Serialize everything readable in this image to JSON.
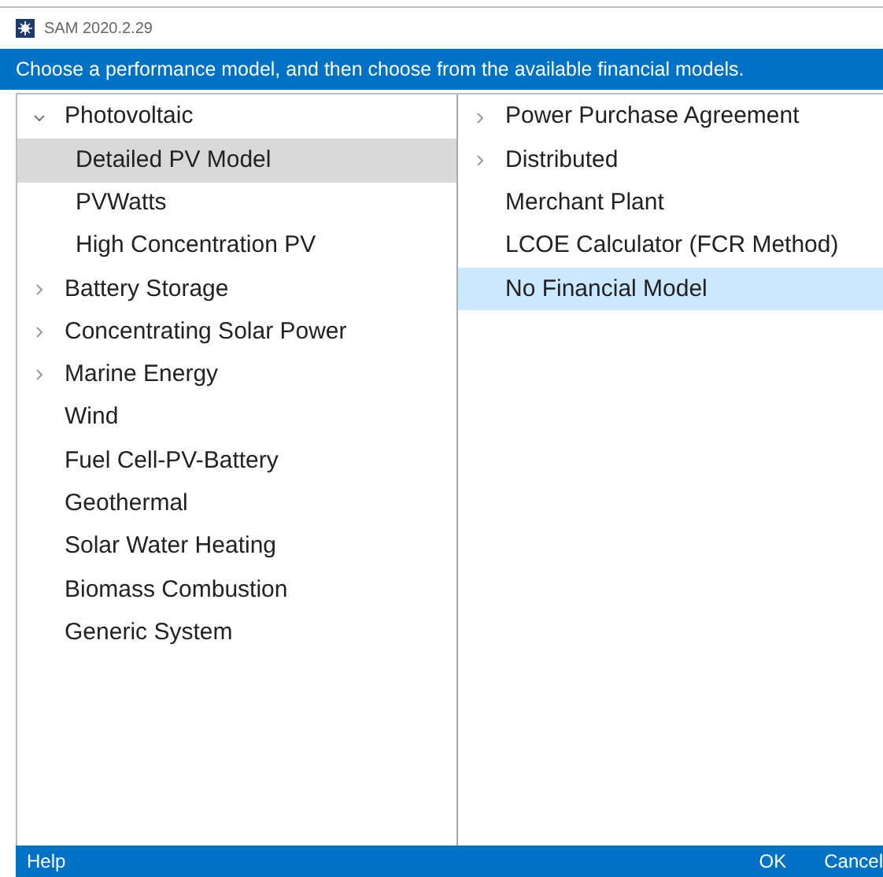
{
  "window": {
    "title": "SAM 2020.2.29"
  },
  "banner": "Choose a performance model, and then choose from the available financial models.",
  "performance_models": [
    {
      "label": "Photovoltaic",
      "expanded": true,
      "selected": false,
      "children": [
        {
          "label": "Detailed PV Model",
          "selected": true
        },
        {
          "label": "PVWatts",
          "selected": false
        },
        {
          "label": "High Concentration PV",
          "selected": false
        }
      ]
    },
    {
      "label": "Battery Storage",
      "expanded": false,
      "selected": false
    },
    {
      "label": "Concentrating Solar Power",
      "expanded": false,
      "selected": false
    },
    {
      "label": "Marine Energy",
      "expanded": false,
      "selected": false
    },
    {
      "label": "Wind",
      "selected": false
    },
    {
      "label": "Fuel Cell-PV-Battery",
      "selected": false
    },
    {
      "label": "Geothermal",
      "selected": false
    },
    {
      "label": "Solar Water Heating",
      "selected": false
    },
    {
      "label": "Biomass Combustion",
      "selected": false
    },
    {
      "label": "Generic System",
      "selected": false
    }
  ],
  "financial_models": [
    {
      "label": "Power Purchase Agreement",
      "expanded": false,
      "selected": false
    },
    {
      "label": "Distributed",
      "expanded": false,
      "selected": false
    },
    {
      "label": "Merchant Plant",
      "selected": false
    },
    {
      "label": "LCOE Calculator (FCR Method)",
      "selected": false
    },
    {
      "label": "No Financial Model",
      "selected": true
    }
  ],
  "footer": {
    "help": "Help",
    "buttons": [
      "OK",
      "Cancel"
    ]
  }
}
